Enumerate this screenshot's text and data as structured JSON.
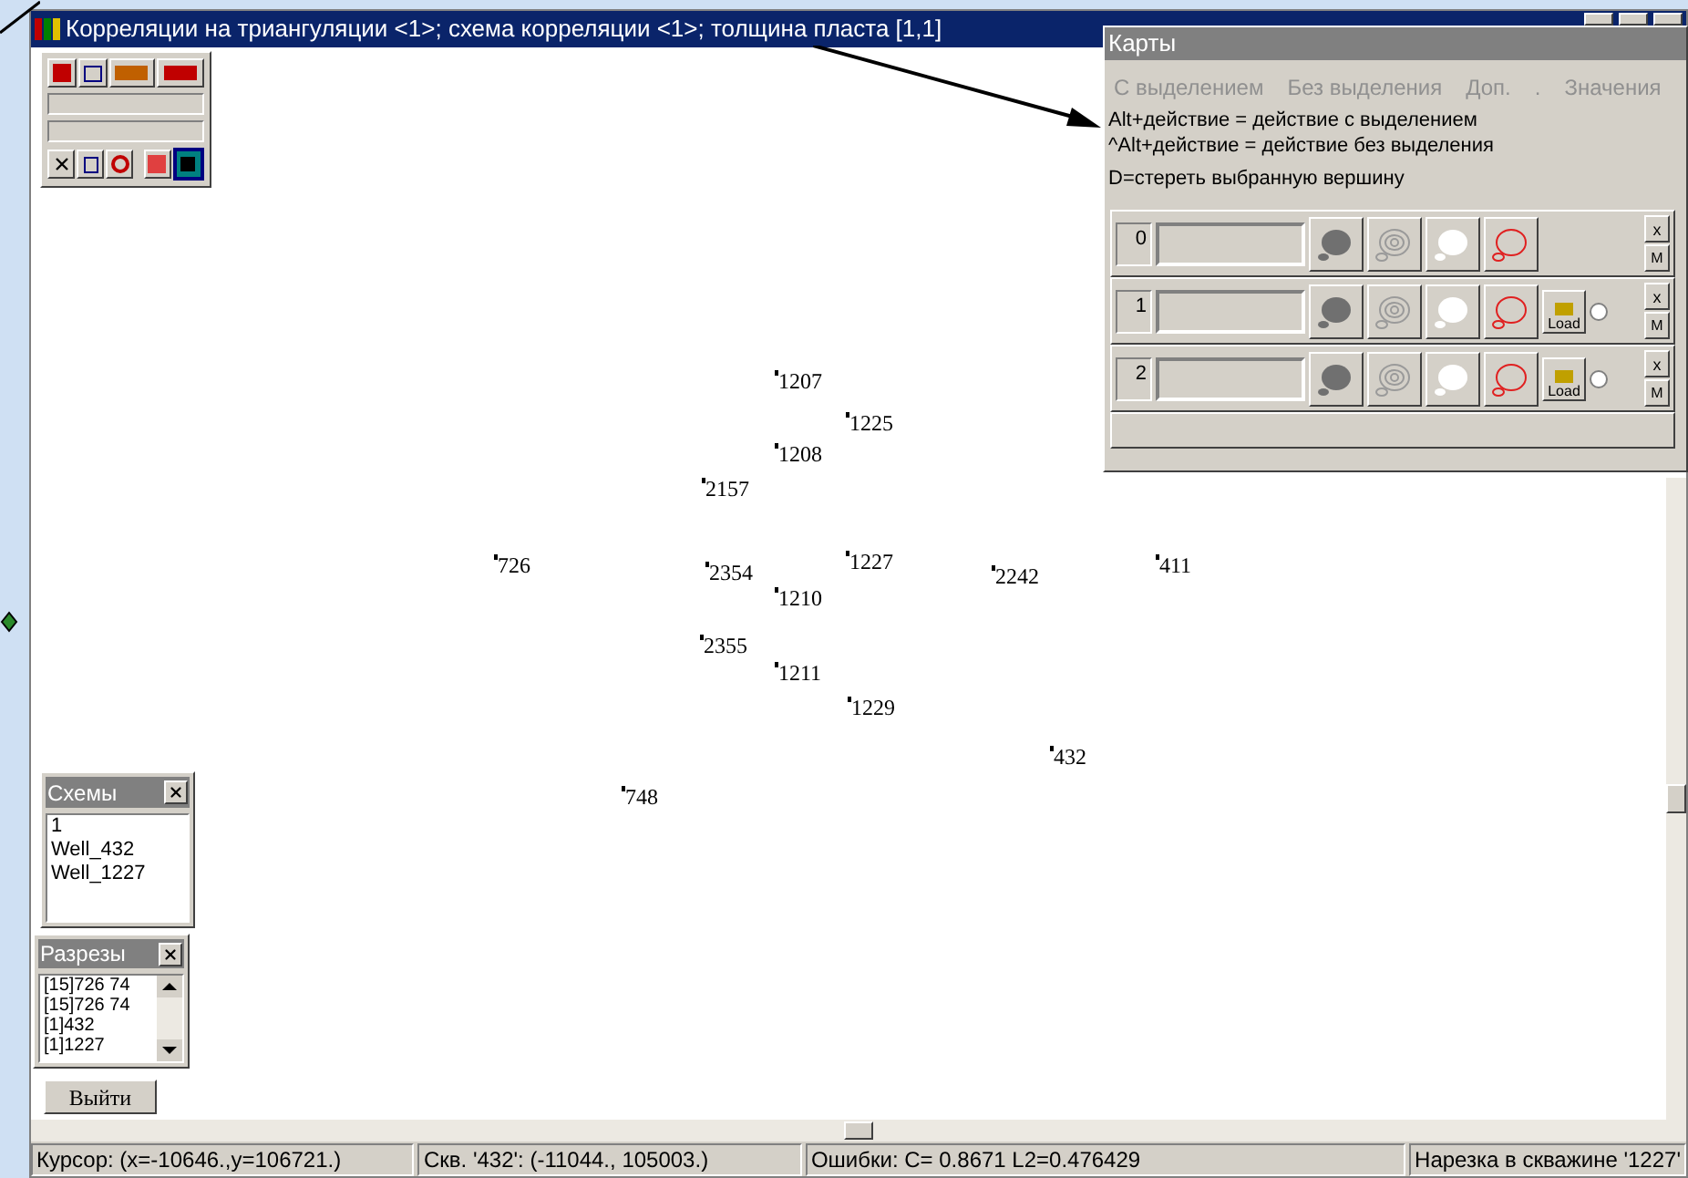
{
  "window": {
    "title": "Корреляции на триангуляции <1>; схема корреляции <1>; толщина пласта [1,1]"
  },
  "wells": [
    {
      "label": "1207"
    },
    {
      "label": "1225"
    },
    {
      "label": "1208"
    },
    {
      "label": "2157"
    },
    {
      "label": "726"
    },
    {
      "label": "2354"
    },
    {
      "label": "1227"
    },
    {
      "label": "1210"
    },
    {
      "label": "2242"
    },
    {
      "label": "411"
    },
    {
      "label": "2355"
    },
    {
      "label": "1211"
    },
    {
      "label": "1229"
    },
    {
      "label": "432"
    },
    {
      "label": "748"
    }
  ],
  "maps_panel": {
    "title": "Карты",
    "menu": [
      "С выделением",
      "Без выделения",
      "Доп.",
      ".",
      "Значения"
    ],
    "hints": [
      "Alt+действие = действие с выделением",
      "^Alt+действие = действие без выделения",
      "D=стереть выбранную вершину"
    ],
    "layers": [
      {
        "number": "0",
        "kind": "base",
        "close_label": "x",
        "m_label": "M"
      },
      {
        "number": "1",
        "kind": "loadable",
        "load_label": "Load",
        "selected": false,
        "close_label": "x",
        "m_label": "M"
      },
      {
        "number": "2",
        "kind": "loadable",
        "load_label": "Load",
        "selected": false,
        "close_label": "x",
        "m_label": "M"
      }
    ]
  },
  "schemes_panel": {
    "title": "Схемы",
    "items": [
      "1",
      "Well_432",
      "Well_1227"
    ]
  },
  "sections_panel": {
    "title": "Разрезы",
    "items": [
      "[15]726 74",
      "[15]726 74",
      "[1]432",
      "[1]1227"
    ]
  },
  "exit_button": "Выйти",
  "status_bar": [
    "Курсор: (x=-10646.,y=106721.)",
    "Скв. '432': (-11044., 105003.)",
    "Ошибки: C=  0.8671 L2=0.476429",
    "Нарезка в скважине '1227'"
  ]
}
